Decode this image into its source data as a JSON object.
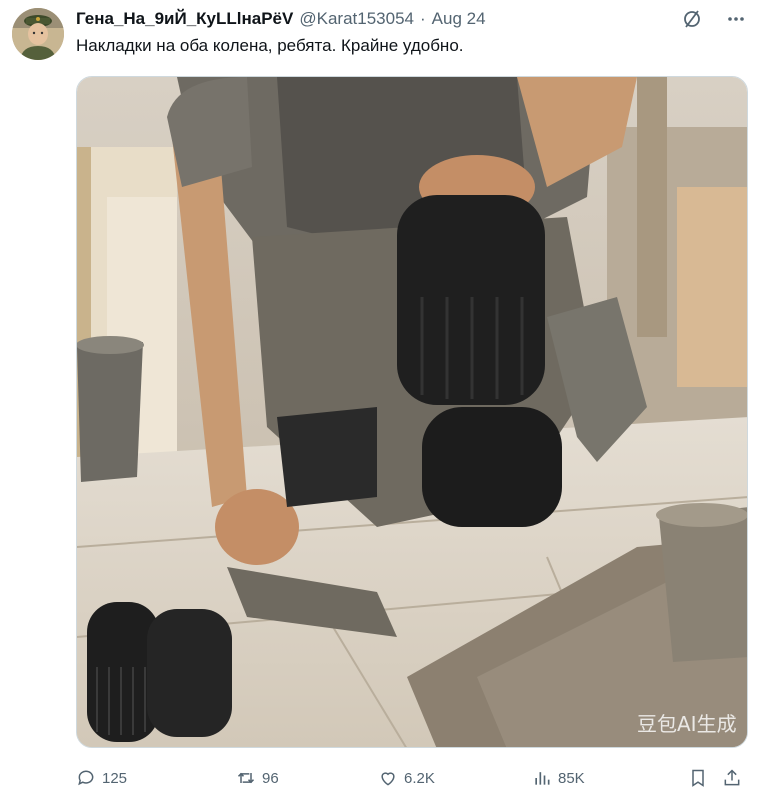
{
  "tweet": {
    "display_name": "Гена_На_9иЙ_КуLLlнаРёV",
    "handle": "@Karat153054",
    "separator": "·",
    "date": "Aug 24",
    "text": "Накладки на оба колена, ребята. Крайне удобно.",
    "watermark": "豆包AI生成"
  },
  "header_icons": [
    "grok-icon",
    "more-icon"
  ],
  "actions": {
    "reply": "125",
    "retweet": "96",
    "like": "6.2K",
    "views": "85K"
  },
  "colors": {
    "text": "#0f1419",
    "secondary": "#536471",
    "border": "#cfd9de"
  }
}
